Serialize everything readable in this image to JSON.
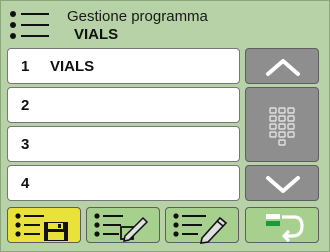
{
  "header": {
    "title": "Gestione programma",
    "subtitle": "VIALS",
    "icon": "menu-list-icon"
  },
  "list": {
    "rows": [
      {
        "number": "1",
        "name": "VIALS"
      },
      {
        "number": "2",
        "name": ""
      },
      {
        "number": "3",
        "name": ""
      },
      {
        "number": "4",
        "name": ""
      }
    ]
  },
  "side_buttons": {
    "up": "chevron-up-icon",
    "keypad": "keypad-icon",
    "down": "chevron-down-icon"
  },
  "tabs": [
    {
      "icon": "list-save-icon",
      "state": "active"
    },
    {
      "icon": "list-edit-icon",
      "state": "inactive"
    },
    {
      "icon": "list-pencil-icon",
      "state": "inactive"
    },
    {
      "icon": "return-icon",
      "state": "inactive"
    }
  ],
  "colors": {
    "background": "#b6d2a6",
    "active_tab": "#e8e23a",
    "inactive_tab": "#a7cf8e",
    "side_button": "#8e8e8e"
  }
}
